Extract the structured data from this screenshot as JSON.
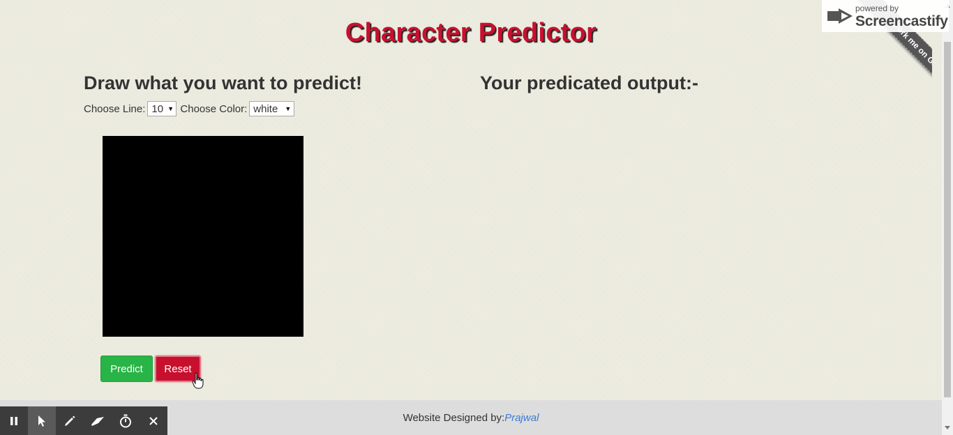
{
  "header": {
    "title": "Character Predictor"
  },
  "left_panel": {
    "heading": "Draw what you want to predict!",
    "line_label": "Choose Line:",
    "line_value": "10",
    "color_label": "Choose Color:",
    "color_value": "white",
    "canvas_color": "#000000",
    "predict_label": "Predict",
    "reset_label": "Reset"
  },
  "right_panel": {
    "heading": "Your predicated output:-"
  },
  "footer": {
    "prefix": "Website Designed by:",
    "author": "Prajwal"
  },
  "ribbon": {
    "text": "Fork me on GitHub"
  },
  "screencastify": {
    "powered_by": "powered by",
    "brand": "Screencastify"
  },
  "recorder_toolbar": {
    "icons": [
      "pause-icon",
      "pointer-icon",
      "pen-icon",
      "eraser-icon",
      "timer-icon",
      "close-icon"
    ]
  },
  "colors": {
    "title_red": "#c8102e",
    "predict_green": "#28b446",
    "reset_red": "#c8102e",
    "author_link": "#3a7bd5",
    "background": "#efeee2",
    "footer_bg": "#dddddd"
  }
}
